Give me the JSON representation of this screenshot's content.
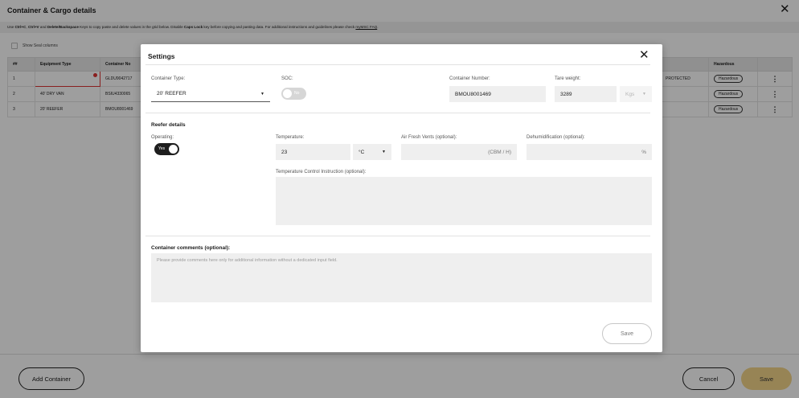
{
  "page": {
    "title": "Container & Cargo details",
    "close_icon": "close-icon",
    "info": {
      "p1": "Use ",
      "k1": "Ctrl+C",
      "p2": ", ",
      "k2": "Ctrl+V",
      "p3": " and ",
      "k3": "Delete/Backspace",
      "p4": " Keys to copy paste and delete values in the grid below. Disable ",
      "k4": "Caps Lock",
      "p5": " key before copying and pasting data. For additional instructions and guidelines please check ",
      "link": "myMSC FAQ",
      "p6": "."
    },
    "show_seal_label": "Show Seal columns"
  },
  "grid": {
    "headers": [
      "##",
      "Equipment Type",
      "Container No",
      "",
      "",
      "",
      "",
      "",
      "",
      "",
      "",
      "",
      "",
      "",
      "",
      "Hazardous",
      ""
    ],
    "rows": [
      {
        "num": "1",
        "equipment": "",
        "container": "GLDU9042717",
        "type": "PROTECTED",
        "hazardous": "Hazardous"
      },
      {
        "num": "2",
        "equipment": "40' DRY VAN",
        "container": "BSIU4330065",
        "type": "",
        "hazardous": "Hazardous"
      },
      {
        "num": "3",
        "equipment": "20' REEFER",
        "container": "BMOU8001469",
        "type": "",
        "hazardous": "Hazardous"
      }
    ]
  },
  "footer": {
    "add_container": "Add Container",
    "cancel": "Cancel",
    "save": "Save"
  },
  "modal": {
    "title": "Settings",
    "close_icon": "close-icon",
    "container_type": {
      "label": "Container Type:",
      "value": "20' REEFER"
    },
    "soc": {
      "label": "SOC:",
      "state": "No"
    },
    "container_number": {
      "label": "Container Number:",
      "value": "BMOU8001469"
    },
    "tare_weight": {
      "label": "Tare weight:",
      "value": "3289",
      "unit": "Kgs"
    },
    "reefer": {
      "section_title": "Reefer details",
      "operating": {
        "label": "Operating:",
        "state": "Yes"
      },
      "temperature": {
        "label": "Temperature:",
        "value": "23",
        "unit": "°C"
      },
      "vents": {
        "label": "Air Fresh Vents (optional):",
        "unit": "(CBM / H)"
      },
      "dehumid": {
        "label": "Dehumidification (optional):",
        "unit": "%"
      },
      "tci": {
        "label": "Temperature Control Instruction (optional):"
      }
    },
    "comments": {
      "label": "Container comments (optional):",
      "placeholder": "Please provide comments here only for additional information without a dedicated input field."
    },
    "save": "Save"
  }
}
